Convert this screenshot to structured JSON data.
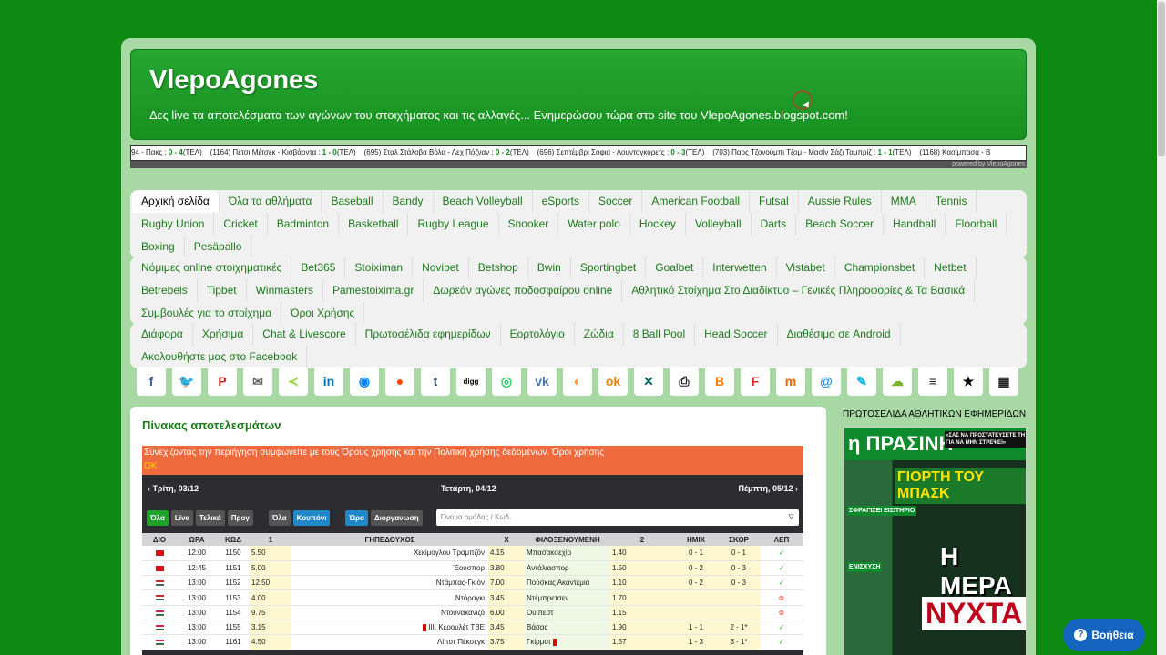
{
  "site": {
    "title": "VlepoAgones",
    "tagline": "Δες live τα αποτελέσματα των αγώνων του στοιχήματος και τις αλλαγές... Ενημερώσου τώρα στο site του VlepoAgones.blogspot.com!"
  },
  "ticker": {
    "items": [
      {
        "text": "94 - Πακς : ",
        "score": "0 - 4",
        "status": "(ΤΕΛ)"
      },
      {
        "text": "(1164) Πέτσι Μέτσεκ - Κισβάρντα : ",
        "score": "1 - 0",
        "status": "(ΤΕΛ)"
      },
      {
        "text": "(695) Σταλ Στάλοβα Βόλα - Λεχ Πόζναν : ",
        "score": "0 - 2",
        "status": "(ΤΕΛ)"
      },
      {
        "text": "(696) Σεπτέμβρι Σόφια - Λουντογκόρετς : ",
        "score": "0 - 3",
        "status": "(ΤΕΛ)"
      },
      {
        "text": "(703) Παρς Τζονούμπι Τζομ - Μασίν Σάζι Ταμπρίζ : ",
        "score": "1 - 1",
        "status": "(ΤΕΛ)"
      },
      {
        "text": "(1168) Κασίμπασα - Β",
        "score": "",
        "status": ""
      }
    ],
    "footer": "powered by VlepoAgones"
  },
  "menu1": [
    "Αρχική σελίδα",
    "Όλα τα αθλήματα",
    "Baseball",
    "Bandy",
    "Beach Volleyball",
    "eSports",
    "Soccer",
    "American Football",
    "Futsal",
    "Aussie Rules",
    "MMA",
    "Tennis",
    "Rugby Union",
    "Cricket",
    "Badminton",
    "Basketball",
    "Rugby League",
    "Snooker",
    "Water polo",
    "Hockey",
    "Volleyball",
    "Darts",
    "Beach Soccer",
    "Handball",
    "Floorball",
    "Boxing",
    "Pesäpallo"
  ],
  "menu2": [
    "Νόμιμες online στοιχηματικές",
    "Bet365",
    "Stoiximan",
    "Novibet",
    "Betshop",
    "Bwin",
    "Sportingbet",
    "Goalbet",
    "Interwetten",
    "Vistabet",
    "Championsbet",
    "Netbet",
    "Betrebels",
    "Tipbet",
    "Winmasters",
    "Pamestoixima.gr",
    "Δωρεάν αγώνες ποδοσφαίρου online",
    "Αθλητικό Στοίχημα Στο Διαδίκτυο – Γενικές Πληροφορίες & Τα Βασικά",
    "Συμβουλές για το στοίχημα",
    "Όροι Χρήσης"
  ],
  "menu3": [
    "Διάφορα",
    "Χρήσιμα",
    "Chat & Livescore",
    "Πρωτοσέλιδα εφημερίδων",
    "Εορτολόγιο",
    "Ζώδια",
    "8 Ball Pool",
    "Head Soccer",
    "Διαθέσιμο σε Android",
    "Ακολουθήστε μας στο Facebook"
  ],
  "share": [
    {
      "icon": "facebook-icon",
      "glyph": "f",
      "color": "#3b5998"
    },
    {
      "icon": "twitter-icon",
      "glyph": "🐦",
      "color": "#1da1f2"
    },
    {
      "icon": "pinterest-icon",
      "glyph": "P",
      "color": "#cb2027"
    },
    {
      "icon": "email-icon",
      "glyph": "✉",
      "color": "#666666"
    },
    {
      "icon": "share-icon",
      "glyph": "≺",
      "color": "#95d03a"
    },
    {
      "icon": "linkedin-icon",
      "glyph": "in",
      "color": "#0077b5"
    },
    {
      "icon": "messenger-icon",
      "glyph": "◉",
      "color": "#0084ff"
    },
    {
      "icon": "reddit-icon",
      "glyph": "●",
      "color": "#ff4500"
    },
    {
      "icon": "tumblr-icon",
      "glyph": "t",
      "color": "#35465c"
    },
    {
      "icon": "digg-icon",
      "glyph": "digg",
      "color": "#000000"
    },
    {
      "icon": "whatsapp-icon",
      "glyph": "◎",
      "color": "#25d366"
    },
    {
      "icon": "vk-icon",
      "glyph": "vk",
      "color": "#4a76a8"
    },
    {
      "icon": "weibo-icon",
      "glyph": "◐",
      "color": "#ff9933"
    },
    {
      "icon": "odnoklassniki-icon",
      "glyph": "ok",
      "color": "#ee8208"
    },
    {
      "icon": "xing-icon",
      "glyph": "✕",
      "color": "#026466"
    },
    {
      "icon": "print-icon",
      "glyph": "⎙",
      "color": "#222222"
    },
    {
      "icon": "blogger-icon",
      "glyph": "B",
      "color": "#f57d00"
    },
    {
      "icon": "flipboard-icon",
      "glyph": "F",
      "color": "#e12828"
    },
    {
      "icon": "meneame-icon",
      "glyph": "m",
      "color": "#ff6400"
    },
    {
      "icon": "mailru-icon",
      "glyph": "@",
      "color": "#168de2"
    },
    {
      "icon": "livejournal-icon",
      "glyph": "✎",
      "color": "#00b0ea"
    },
    {
      "icon": "wechat-icon",
      "glyph": "☁",
      "color": "#7bb32e"
    },
    {
      "icon": "buffer-icon",
      "glyph": "≡",
      "color": "#222222"
    },
    {
      "icon": "star-icon",
      "glyph": "★",
      "color": "#000000"
    },
    {
      "icon": "qrcode-icon",
      "glyph": "▦",
      "color": "#222222"
    }
  ],
  "results": {
    "title": "Πίνακας αποτελεσμάτων",
    "cookie": "Συνεχίζοντας την περιήγηση συμφωνείτε με τους Όρους χρήσης και την Πολιτική χρήσης δεδομένων. Όροι χρήσης",
    "cookie_ok": "OK",
    "prev_day": "‹ Τρίτη, 03/12",
    "current_day": "Τετάρτη, 04/12",
    "next_day": "Πέμπτη, 05/12 ›",
    "filters1": [
      "Όλα",
      "Live",
      "Τελικά",
      "Προγ"
    ],
    "filters2": [
      "Όλα",
      "Κουπόνι"
    ],
    "filters3": [
      "Ώρα",
      "Διοργανωση"
    ],
    "search_placeholder": "Όνομα ομάδας / Κωδ.",
    "headers": [
      "ΔΙΟ",
      "ΩΡΑ",
      "ΚΩΔ",
      "1",
      "ΓΗΠΕΔΟΥΧΟΣ",
      "Χ",
      "ΦΙΛΟΞΕΝΟΥΜΕΝΗ",
      "2",
      "ΗΜΙΧ",
      "ΣΚΟΡ",
      "ΛΕΠ"
    ],
    "rows": [
      {
        "flag": "tr",
        "time": "12:00",
        "code": "1150",
        "o1": "5.50",
        "home": "Χεκίμογλου Τραμπζόν",
        "ox": "4.15",
        "away": "Μπασακσεχίρ",
        "o2": "1.40",
        "ht": "0 - 1",
        "score": "0 - 1",
        "st": "ok"
      },
      {
        "flag": "tr",
        "time": "12:45",
        "code": "1151",
        "o1": "5.00",
        "home": "Έουσπορ",
        "ox": "3.80",
        "away": "Αντάλιασπορ",
        "o2": "1.50",
        "ht": "0 - 2",
        "score": "0 - 3",
        "st": "ok"
      },
      {
        "flag": "hu",
        "time": "13:00",
        "code": "1152",
        "o1": "12.50",
        "home": "Ντάμπας-Γκιόν",
        "ox": "7.00",
        "away": "Πούσκας Ακαντέμια",
        "o2": "1.10",
        "ht": "0 - 2",
        "score": "0 - 3",
        "st": "ok"
      },
      {
        "flag": "hu",
        "time": "13:00",
        "code": "1153",
        "o1": "4.00",
        "home": "Ντόρογκι",
        "ox": "3.45",
        "away": "Ντέμπρετσεν",
        "o2": "1.70",
        "ht": "",
        "score": "",
        "st": "x"
      },
      {
        "flag": "hu",
        "time": "13:00",
        "code": "1154",
        "o1": "9.75",
        "home": "Ντουνακανιζό",
        "ox": "6.00",
        "away": "Ουίπεστ",
        "o2": "1.15",
        "ht": "",
        "score": "",
        "st": "x"
      },
      {
        "flag": "hu",
        "time": "13:00",
        "code": "1155",
        "o1": "3.15",
        "home": "III. Κερουλέτ ΤΒΕ",
        "ox": "3.45",
        "away": "Βάσας",
        "o2": "1.90",
        "ht": "1 - 1",
        "score": "2 - 1*",
        "st": "ok",
        "red_home": true
      },
      {
        "flag": "hu",
        "time": "13:00",
        "code": "1161",
        "o1": "4.50",
        "home": "Λίποτ Πέκσεγκ",
        "ox": "3.75",
        "away": "Γκίρμοτ",
        "o2": "1.57",
        "ht": "1 - 3",
        "score": "3 - 1*",
        "st": "ok",
        "red_away": true
      }
    ]
  },
  "sidebar": {
    "title": "ΠΡΩΤΟΣΕΛΙΔΑ ΑΘΛΗΤΙΚΩΝ ΕΦΗΜΕΡΙΔΩΝ",
    "paper_name": "η ΠΡΑΣΙΝΗ",
    "paper_sub": "«ΣΑΣ ΝΑ ΠΡΟΣΤΑΤΕΥΣΕΤΕ ΤΗ ΓΙΑ ΝΑ ΜΗΝ ΣΤΡΕΨΕΙ»",
    "headline": "ΓΙΟΡΤΗ ΤΟΥ ΜΠΑΣΚ",
    "big": "Η ΜΕΡΑ",
    "big2": "ΝΥΧΤΑ",
    "lbl1": "ΣΦΡΑΓΙΖΕΙ ΕΙΣΙΤΗΡΙΟ",
    "lbl2": "ΕΝΙΣΧΥΣΗ"
  },
  "help": {
    "label": "Βοήθεια"
  }
}
